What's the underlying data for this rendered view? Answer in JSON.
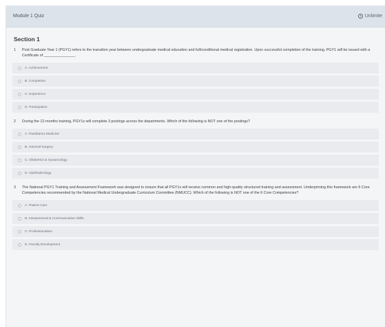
{
  "header": {
    "title": "Module 1 Quiz",
    "time_label": "Unlimite"
  },
  "section": {
    "title": "Section 1"
  },
  "questions": [
    {
      "number": "1",
      "text": "Post Graduate Year 1 (PGY1) refers to the transition year between undergraduate medical education and full/conditional medical registration. Upon successful completion of the training, PGY1 will be issued with a Certificate of _______________.",
      "options": [
        "A. Achievement",
        "B. Completion",
        "C. Experience",
        "D. Participation"
      ]
    },
    {
      "number": "2",
      "text": "During the 12-months training, PGY1s will complete 3 postings across the departments. Which of the following is NOT one of the postings?",
      "options": [
        "A. Paediatrics Medicine",
        "B. General Surgery",
        "C. Obstetrics & Gynaecology",
        "D. Ophthalmology"
      ]
    },
    {
      "number": "3",
      "text": "The National PGY1 Training and Assessment Framework was designed to ensure that all PGY1s will receive common and high-quality structured training and assessment. Underpinning this framework are 6 Core Competencies recommended by the National Medical Undergraduate Curriculum Committee (NMUCC). Which of the following is NOT one of the 6 Core Competencies?",
      "options": [
        "A. Patient Care",
        "B. Interpersonal & Communication Skills",
        "C. Professionalism",
        "D. Faculty Development"
      ]
    }
  ]
}
